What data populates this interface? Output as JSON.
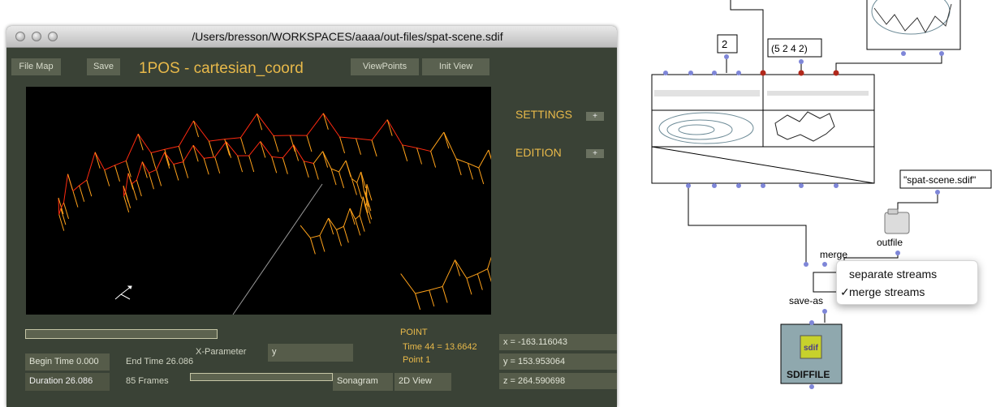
{
  "window": {
    "title": "/Users/bresson/WORKSPACES/aaaa/out-files/spat-scene.sdif"
  },
  "toolbar": {
    "file_map": "File Map",
    "save": "Save",
    "view_title": "1POS - cartesian_coord",
    "viewpoints": "ViewPoints",
    "init_view": "Init View"
  },
  "side": {
    "settings": "SETTINGS",
    "edition": "EDITION",
    "plus": "+"
  },
  "controls": {
    "x_parameter_label": "X-Parameter",
    "x_parameter_value": "y",
    "begin_time": "Begin Time 0.000",
    "end_time": "End Time 26.086",
    "duration": "Duration 26.086",
    "frames": "85 Frames",
    "sonagram": "Sonagram",
    "view_2d": "2D View"
  },
  "point": {
    "header": "POINT",
    "time": "Time 44 = 13.6642",
    "index": "Point 1",
    "x": "x = -163.116043",
    "y": "y = 153.953064",
    "z": "z = 264.590698"
  },
  "patch": {
    "value_2": "2",
    "value_list": "(5 2 4 2)",
    "filename": "\"spat-scene.sdif\"",
    "outfile_label": "outfile",
    "merge_label": "merge",
    "save_label": "save-as",
    "sdiffile_label": "SDIFFILE",
    "sdif_icon_text": "sdif"
  },
  "menu": {
    "items": [
      "separate streams",
      "merge streams"
    ],
    "checkmark": "✓",
    "selected_index": 1
  },
  "colors": {
    "window_bg": "#3a4236",
    "accent_gold": "#e8b94a",
    "curve_red": "#ff2a10",
    "curve_orange": "#ffa21a",
    "inlet_blue": "#7e86d8",
    "outlet_red": "#b1281b"
  }
}
